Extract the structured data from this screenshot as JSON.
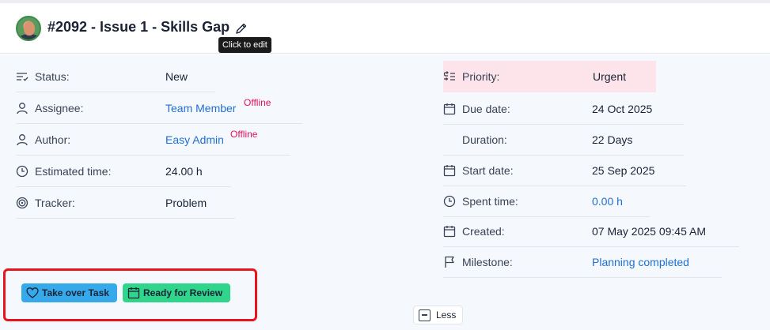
{
  "header": {
    "title": "#2092 - Issue 1 - Skills Gap",
    "edit_tooltip": "Click to edit"
  },
  "left_fields": [
    {
      "label": "Status:",
      "value": "New",
      "icon": "status-list-icon"
    },
    {
      "label": "Assignee:",
      "value": "Team Member",
      "presence": "Offline",
      "icon": "user-icon"
    },
    {
      "label": "Author:",
      "value": "Easy Admin",
      "presence": "Offline",
      "icon": "user-icon"
    },
    {
      "label": "Estimated time:",
      "value": "24.00 h",
      "icon": "clock-icon"
    },
    {
      "label": "Tracker:",
      "value": "Problem",
      "icon": "target-icon"
    }
  ],
  "right_fields": [
    {
      "label": "Priority:",
      "value": "Urgent",
      "icon": "priority-icon"
    },
    {
      "label": "Due date:",
      "value": "24 Oct 2025",
      "icon": "calendar-icon"
    },
    {
      "label": "Duration:",
      "value": "22 Days"
    },
    {
      "label": "Start date:",
      "value": "25 Sep 2025",
      "icon": "calendar-icon"
    },
    {
      "label": "Spent time:",
      "value": "0.00 h",
      "icon": "clock-icon"
    },
    {
      "label": "Created:",
      "value": "07 May 2025 09:45 AM",
      "icon": "calendar-icon"
    },
    {
      "label": "Milestone:",
      "value": "Planning completed",
      "icon": "flag-icon"
    }
  ],
  "actions": {
    "take_over": "Take over Task",
    "ready_for_review": "Ready for Review"
  },
  "toggle": {
    "less_label": "Less"
  },
  "colors": {
    "priority_urgent_bg": "#fce4ea",
    "offline": "#e0115f",
    "link": "#1f6fd1",
    "take_over_button": "#36a9ea",
    "ready_button": "#2fd58a",
    "highlight_box": "#e8161c"
  }
}
